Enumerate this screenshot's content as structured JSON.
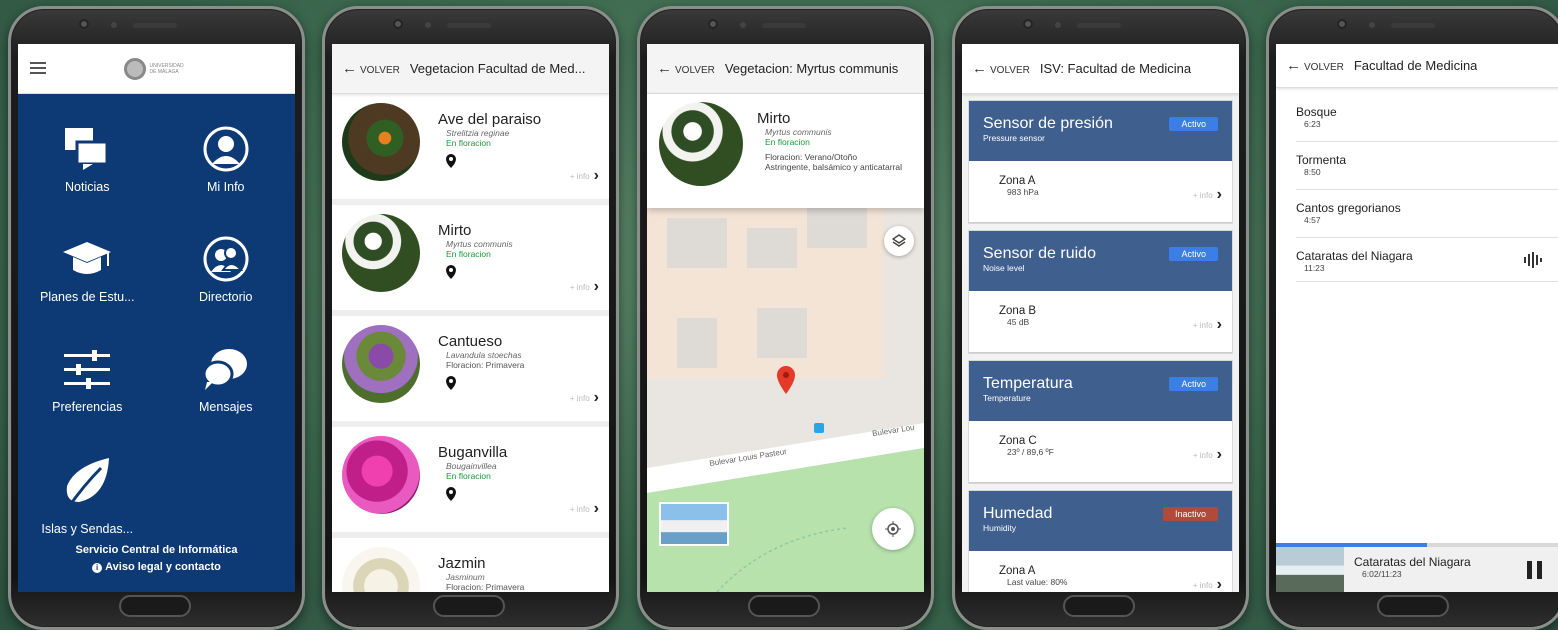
{
  "phone1": {
    "logo_text": "UNIVERSIDAD DE MÁLAGA",
    "tiles": [
      {
        "label": "Noticias",
        "icon": "news-icon"
      },
      {
        "label": "Mi Info",
        "icon": "user-icon"
      },
      {
        "label": "Planes de Estu...",
        "icon": "graduation-cap-icon"
      },
      {
        "label": "Directorio",
        "icon": "directory-icon"
      },
      {
        "label": "Preferencias",
        "icon": "sliders-icon"
      },
      {
        "label": "Mensajes",
        "icon": "chat-icon"
      },
      {
        "label": "Islas y Sendas...",
        "icon": "leaf-icon"
      }
    ],
    "footer_line1": "Servicio Central de Informática",
    "footer_line2": "Aviso legal y contacto"
  },
  "back_label": "VOLVER",
  "more_label": "+ info",
  "phone2": {
    "title": "Vegetacion Facultad de Med...",
    "plants": [
      {
        "name": "Ave del paraiso",
        "sci": "Strelitzia reginae",
        "status": "En floracion"
      },
      {
        "name": "Mirto",
        "sci": "Myrtus communis",
        "status": "En floracion"
      },
      {
        "name": "Cantueso",
        "sci": "Lavandula stoechas",
        "status": "Floracion: Primavera"
      },
      {
        "name": "Buganvilla",
        "sci": "Bougainvillea",
        "status": "En floracion"
      },
      {
        "name": "Jazmin",
        "sci": "Jasminum",
        "status": "Floracion: Primavera"
      }
    ]
  },
  "phone3": {
    "title": "Vegetacion: Myrtus communis",
    "name": "Mirto",
    "sci": "Myrtus communis",
    "status": "En floracion",
    "season": "Floracion: Verano/Otoño",
    "desc": "Astringente, balsámico y anticatarral",
    "street1": "Bulevar Louis Pasteur",
    "street2": "Bulevar Lou"
  },
  "phone4": {
    "title": "ISV: Facultad de Medicina",
    "sensors": [
      {
        "name": "Sensor de presión",
        "sub": "Pressure sensor",
        "status": "Activo",
        "status_color": "#3a7ee6",
        "zone": "Zona A",
        "value": "983 hPa"
      },
      {
        "name": "Sensor de ruido",
        "sub": "Noise level",
        "status": "Activo",
        "status_color": "#3a7ee6",
        "zone": "Zona B",
        "value": "45 dB"
      },
      {
        "name": "Temperatura",
        "sub": "Temperature",
        "status": "Activo",
        "status_color": "#3a7ee6",
        "zone": "Zona C",
        "value": "23º / 89,6 ºF"
      },
      {
        "name": "Humedad",
        "sub": "Humidity",
        "status": "Inactivo",
        "status_color": "#b04a3a",
        "zone": "Zona A",
        "value": "Last value: 80%"
      }
    ]
  },
  "phone5": {
    "title": "Facultad de Medicina",
    "tracks": [
      {
        "name": "Bosque",
        "dur": "6:23"
      },
      {
        "name": "Tormenta",
        "dur": "8:50"
      },
      {
        "name": "Cantos gregorianos",
        "dur": "4:57"
      },
      {
        "name": "Cataratas del Niagara",
        "dur": "11:23"
      }
    ],
    "player": {
      "name": "Cataratas del Niagara",
      "time": "6:02/11:23",
      "progress": 0.53
    }
  }
}
